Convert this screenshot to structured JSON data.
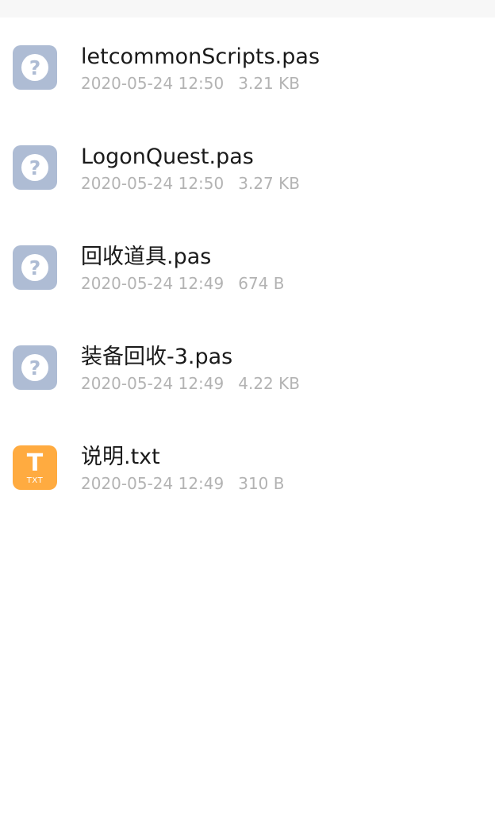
{
  "files": [
    {
      "name": "letcommonScripts.pas",
      "date": "2020-05-24 12:50",
      "size": "3.21 KB",
      "icon": "unknown-file-icon"
    },
    {
      "name": "LogonQuest.pas",
      "date": "2020-05-24 12:50",
      "size": "3.27 KB",
      "icon": "unknown-file-icon"
    },
    {
      "name": "回收道具.pas",
      "date": "2020-05-24 12:49",
      "size": "674 B",
      "icon": "unknown-file-icon"
    },
    {
      "name": "装备回收-3.pas",
      "date": "2020-05-24 12:49",
      "size": "4.22 KB",
      "icon": "unknown-file-icon"
    },
    {
      "name": "说明.txt",
      "date": "2020-05-24 12:49",
      "size": "310 B",
      "icon": "text-file-icon",
      "icon_glyph": "T",
      "icon_label": "TXT"
    }
  ],
  "icon_glyph_unknown": "?",
  "colors": {
    "unknown_icon_bg": "#aebcd4",
    "text_icon_bg": "#ffab40",
    "name_text": "#1a1a1a",
    "meta_text": "#b3b3b3"
  }
}
